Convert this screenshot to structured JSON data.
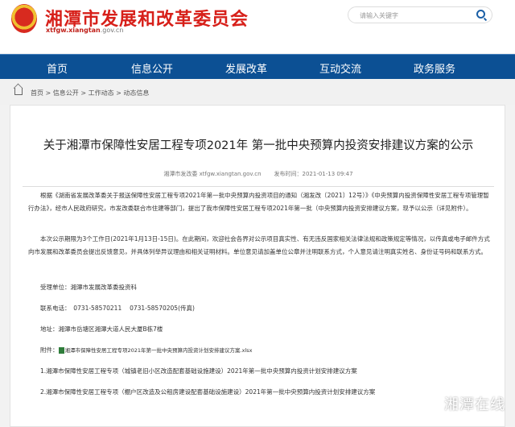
{
  "header": {
    "site_name": "湘潭市发展和改革委员会",
    "domain_bold": "xtfgw.xiangtan",
    "domain_rest": ".gov.cn",
    "search_placeholder": "请输入关键字"
  },
  "nav": [
    "首页",
    "信息公开",
    "发展改革",
    "互动交流",
    "政务服务"
  ],
  "breadcrumb": [
    "首页",
    "信息公开",
    "工作动态",
    "动态信息"
  ],
  "article": {
    "title": "关于湘潭市保障性安居工程专项2021年 第一批中央预算内投资安排建议方案的公示",
    "source": "湘潭市发改委 xtfgw.xiangtan.gov.cn",
    "date": "发布时间：2021-01-13 09:47",
    "p1": "根据《湖南省发展改革委关于报送保障性安居工程专项2021年第一批中央预算内投资项目的通知（湘发改〔2021〕12号）》《中央预算内投资保障性安居工程专项管理暂行办法》，经市人民政府研究，市发改委联合市住建等部门，提出了我市保障性安居工程专项2021年第一批（中央预算内投资安排建议方案，现予以公示（详见附件）。",
    "p2": "本次公示期限为3个工作日(2021年1月13日-15日)。在此期间，欢迎社会各界对公示项目真实性、有无违反国家相关法律法规和政策规定等情况，以传真或电子邮件方式向市发展和改革委员会提出反馈意见，并具体列举异议理由和相关证明材料。单位意见请加盖单位公章并注明联系方式，个人意见请注明真实姓名、身份证号码和联系方式。",
    "unit": "受理单位：湘潭市发展改革委投资科",
    "phone": "联系电话：　0731-58570211　 0731-58570205(传真)",
    "address": "地址：湘潭市岳塘区湘潭大道人民大厦B栋7楼",
    "attachment_label": "附件：",
    "attachment": "湘潭市保障性安居工程专项2021年第一批中央预算内投资计划安排建议方案.xlsx",
    "item1": "1.湘潭市保障性安居工程专项（城镇老旧小区改造配套基础设施建设）2021年第一批中央预算内投资计划安排建议方案",
    "item2": "2.湘潭市保障性安居工程专项（棚户区改造及公租房建设配套基础设施建设）2021年第一批中央预算内投资计划安排建议方案"
  },
  "watermark": "湘潭在线"
}
